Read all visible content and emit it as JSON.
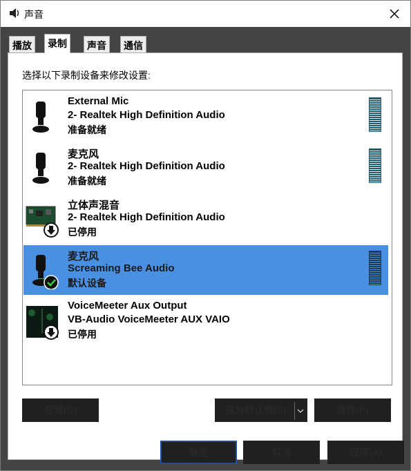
{
  "window": {
    "title": "声音"
  },
  "tabs": [
    {
      "label": "播放",
      "active": false
    },
    {
      "label": "录制",
      "active": true
    },
    {
      "label": "声音",
      "active": false
    },
    {
      "label": "通信",
      "active": false
    }
  ],
  "instruction": "选择以下录制设备来修改设置:",
  "devices": [
    {
      "name": "External Mic",
      "driver": "2- Realtek High Definition Audio",
      "status": "准备就绪",
      "icon": "microphone-icon",
      "meter": true,
      "selected": false
    },
    {
      "name": "麦克风",
      "driver": "2- Realtek High Definition Audio",
      "status": "准备就绪",
      "icon": "microphone-icon",
      "meter": true,
      "selected": false
    },
    {
      "name": "立体声混音",
      "driver": "2- Realtek High Definition Audio",
      "status": "已停用",
      "icon": "sound-card-icon",
      "badge": "disabled-arrow-icon",
      "meter": false,
      "selected": false
    },
    {
      "name": "麦克风",
      "driver": "Screaming Bee Audio",
      "status": "默认设备",
      "icon": "microphone-icon",
      "badge": "default-check-icon",
      "meter": true,
      "selected": true
    },
    {
      "name": "VoiceMeeter Aux Output",
      "driver": "VB-Audio VoiceMeeter AUX VAIO",
      "status": "已停用",
      "icon": "voicemeeter-icon",
      "badge": "disabled-arrow-icon",
      "meter": false,
      "selected": false
    }
  ],
  "buttons": {
    "configure": "配置(C)",
    "set_default": "设为默认值(S)",
    "properties": "属性(P)",
    "ok": "确定",
    "cancel": "取消",
    "apply": "应用(A)"
  },
  "colors": {
    "selection": "#4a90e2",
    "meter": "#1d5b70",
    "dark_area": "#444444",
    "button": "#202020"
  }
}
